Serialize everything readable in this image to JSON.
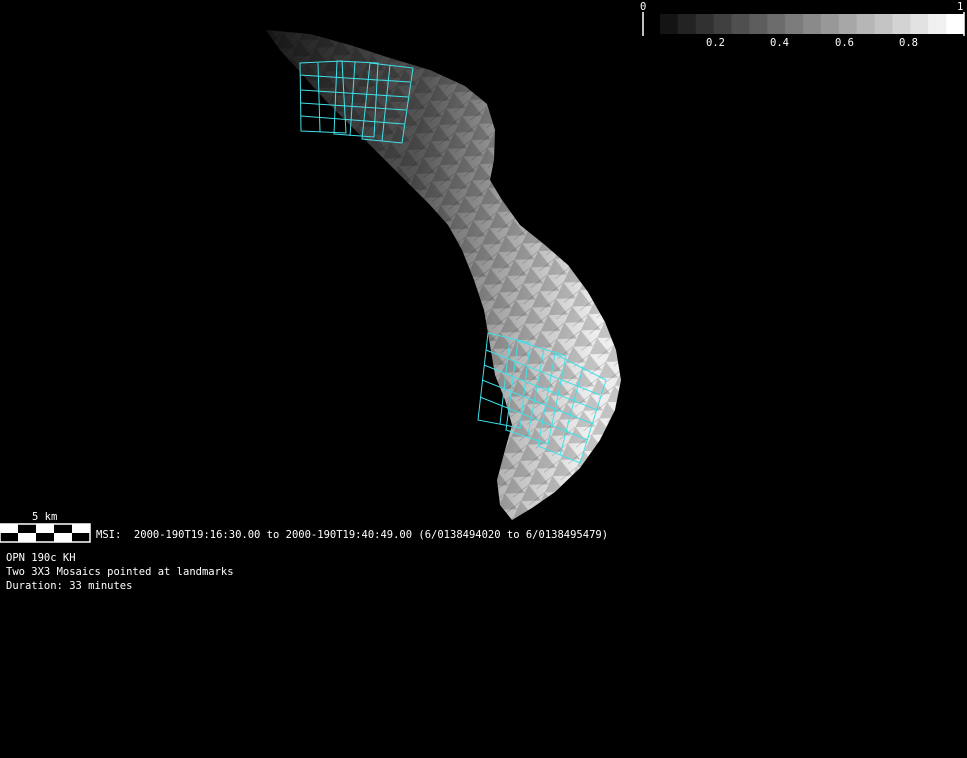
{
  "colorbar": {
    "min_label": "0",
    "max_label": "1",
    "tick_labels": [
      "0.2",
      "0.4",
      "0.6",
      "0.8"
    ],
    "tick_values": [
      0.2,
      0.4,
      0.6,
      0.8
    ],
    "bin_count": 17
  },
  "scale_bar": {
    "label": "5 km"
  },
  "info": {
    "msi_line": "MSI:  2000-190T19:16:30.00 to 2000-190T19:40:49.00 (6/0138494020 to 6/0138495479)",
    "line1": "OPN 190c KH",
    "line2": "Two 3X3 Mosaics pointed at landmarks",
    "line3": "Duration: 33 minutes"
  },
  "colors": {
    "background": "#000000",
    "footprint": "#40e0e8",
    "text": "#ffffff"
  }
}
